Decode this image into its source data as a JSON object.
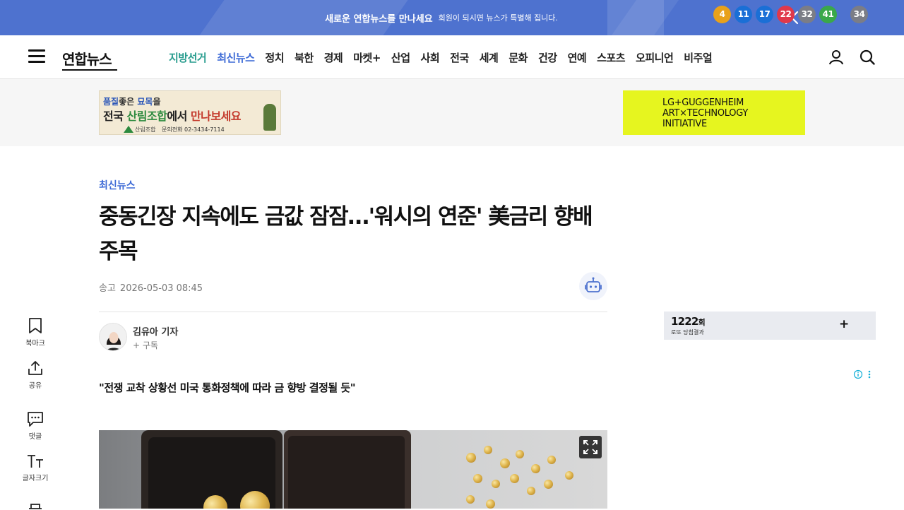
{
  "banner": {
    "title": "새로운 연합뉴스를 만나세요",
    "subtitle": "회원이 되시면 뉴스가 특별해 집니다."
  },
  "header": {
    "logo": "연합뉴스",
    "nav": [
      "지방선거",
      "최신뉴스",
      "정치",
      "북한",
      "경제",
      "마켓+",
      "산업",
      "사회",
      "전국",
      "세계",
      "문화",
      "건강",
      "연예",
      "스포츠",
      "오피니언",
      "비주얼"
    ]
  },
  "ads": {
    "left": {
      "line1_prefix": "품질",
      "line1_mid": "좋은 ",
      "line1_brand": "묘목",
      "line1_suffix": "을",
      "line2_a": "전국 ",
      "line2_b": "산림조합",
      "line2_c": "에서 ",
      "line2_d": "만나보세요",
      "org": "산림조합",
      "phone": "문의전화 02-3434-7114"
    },
    "right": {
      "line1": "LG+GUGGENHEIM",
      "line2": "ART×TECHNOLOGY",
      "line3": "INITIATIVE"
    }
  },
  "article": {
    "category": "최신뉴스",
    "headline": "중동긴장 지속에도 금값 잠잠…'워시의 연준' 美금리 향배 주목",
    "date_label": "송고",
    "date": "2026-05-03 08:45",
    "reporter": "김유아 기자",
    "subscribe": "+ 구독",
    "quote": "\"전쟁 교착 상황선 미국 통화정책에 따라 금 향방 결정될 듯\""
  },
  "lotto": {
    "round": "1222",
    "round_suffix": "회",
    "result_label": "로또 당첨결과",
    "numbers": [
      "4",
      "11",
      "17",
      "22",
      "32",
      "41"
    ],
    "bonus": "34",
    "colors": [
      "#e8a11a",
      "#1a6fd6",
      "#1a6fd6",
      "#e0384a",
      "#7b7d86",
      "#3aa84a",
      "#7b7d86"
    ]
  },
  "rail": {
    "bookmark": "북마크",
    "share": "공유",
    "comment": "댓글",
    "font_size": "글자크기"
  },
  "colors": {
    "banner": "#4e72cf",
    "accent_blue": "#3d6ad6",
    "accent_teal": "#2a9d8f"
  }
}
